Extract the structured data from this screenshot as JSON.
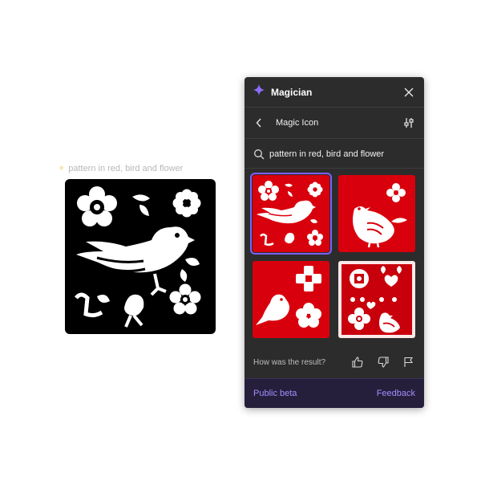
{
  "canvas": {
    "prompt_caption": "pattern in red, bird and flower",
    "icons": {
      "sparkle": "sparkle-icon"
    }
  },
  "panel": {
    "title": "Magician",
    "subheader_label": "Magic Icon",
    "search": {
      "value": "pattern in red, bird and flower",
      "placeholder": ""
    },
    "results": [
      {
        "name": "result-bird-flower-pattern",
        "selected": true
      },
      {
        "name": "result-bird-flower-red",
        "selected": false
      },
      {
        "name": "result-bird-flowers-simple",
        "selected": false
      },
      {
        "name": "result-bird-hearts-pattern",
        "selected": false
      }
    ],
    "feedback_question": "How was the result?",
    "footer": {
      "left": "Public beta",
      "right": "Feedback"
    },
    "colors": {
      "accent": "#7b61ff",
      "result_red": "#d8000c",
      "panel_bg": "#2c2c2c",
      "footer_link": "#a58cff"
    }
  }
}
